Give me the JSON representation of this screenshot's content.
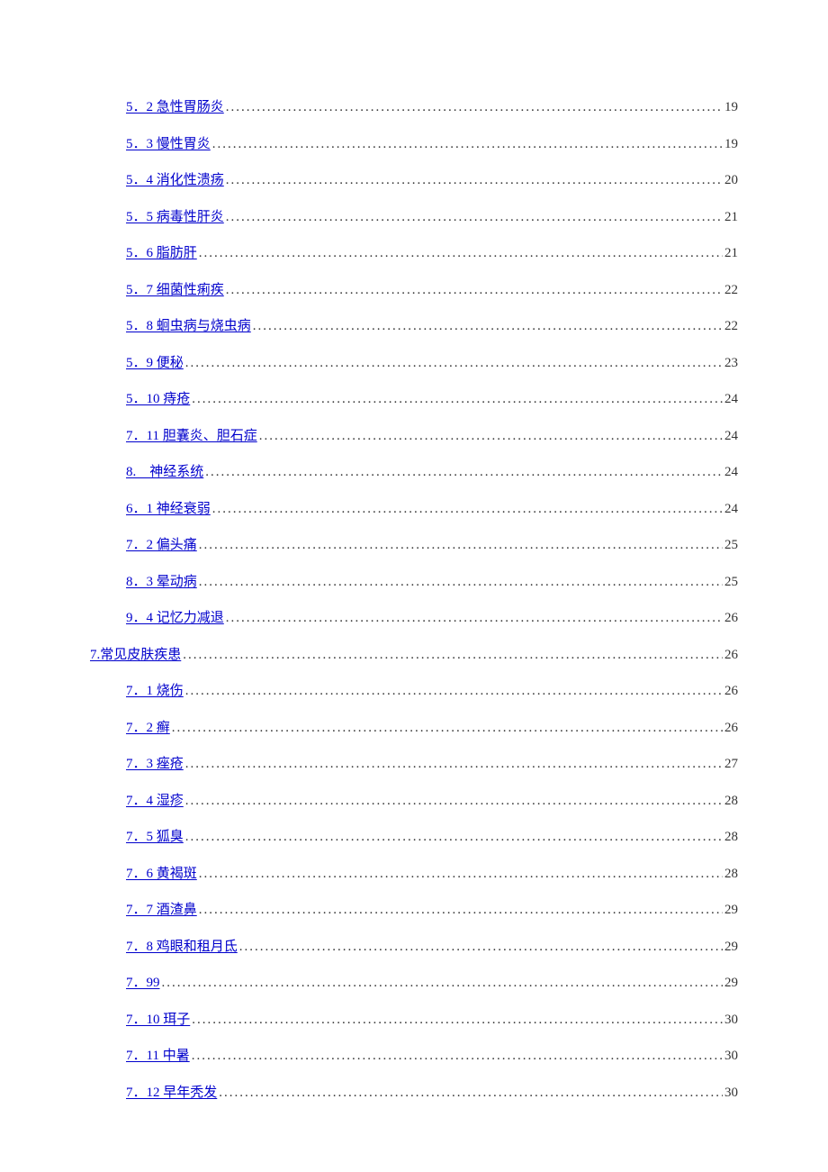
{
  "toc": [
    {
      "level": 2,
      "label": "5．2 急性胃肠炎",
      "page": "19"
    },
    {
      "level": 2,
      "label": "5．3 慢性胃炎",
      "page": "19"
    },
    {
      "level": 2,
      "label": "5．4 消化性溃疡",
      "page": "20"
    },
    {
      "level": 2,
      "label": "5．5 病毒性肝炎",
      "page": "21"
    },
    {
      "level": 2,
      "label": "5．6 脂肪肝",
      "page": "21"
    },
    {
      "level": 2,
      "label": "5．7 细菌性痢疾",
      "page": "22"
    },
    {
      "level": 2,
      "label": "5．8 蛔虫病与烧虫病",
      "page": "22"
    },
    {
      "level": 2,
      "label": "5．9 便秘",
      "page": "23"
    },
    {
      "level": 2,
      "label": "5．10 痔疮",
      "page": "24"
    },
    {
      "level": 2,
      "label": "7．11 胆囊炎、胆石症",
      "page": "24"
    },
    {
      "level": 2,
      "label": "8.　神经系统",
      "page": "24"
    },
    {
      "level": 2,
      "label": "6．1 神经衰弱",
      "page": "24"
    },
    {
      "level": 2,
      "label": "7．2 偏头痛",
      "page": "25"
    },
    {
      "level": 2,
      "label": "8．3 晕动病",
      "page": "25"
    },
    {
      "level": 2,
      "label": "9．4 记忆力减退",
      "page": "26"
    },
    {
      "level": 1,
      "label": "7.常见皮肤疾患",
      "page": "26"
    },
    {
      "level": 2,
      "label": "7．1 烧伤",
      "page": "26"
    },
    {
      "level": 2,
      "label": "7．2 癣",
      "page": "26"
    },
    {
      "level": 2,
      "label": "7．3 痤疮",
      "page": "27"
    },
    {
      "level": 2,
      "label": "7．4 湿疹",
      "page": "28"
    },
    {
      "level": 2,
      "label": "7．5 狐臭",
      "page": "28"
    },
    {
      "level": 2,
      "label": "7．6 黄褐斑",
      "page": "28"
    },
    {
      "level": 2,
      "label": "7．7 酒渣鼻",
      "page": "29"
    },
    {
      "level": 2,
      "label": "7．8 鸡眼和租月氐",
      "page": "29"
    },
    {
      "level": 2,
      "label": "7．99",
      "page": "29"
    },
    {
      "level": 2,
      "label": "7．10 珥子",
      "page": "30"
    },
    {
      "level": 2,
      "label": "7．11 中暑",
      "page": "30"
    },
    {
      "level": 2,
      "label": "7．12 早年秃发",
      "page": "30"
    }
  ]
}
